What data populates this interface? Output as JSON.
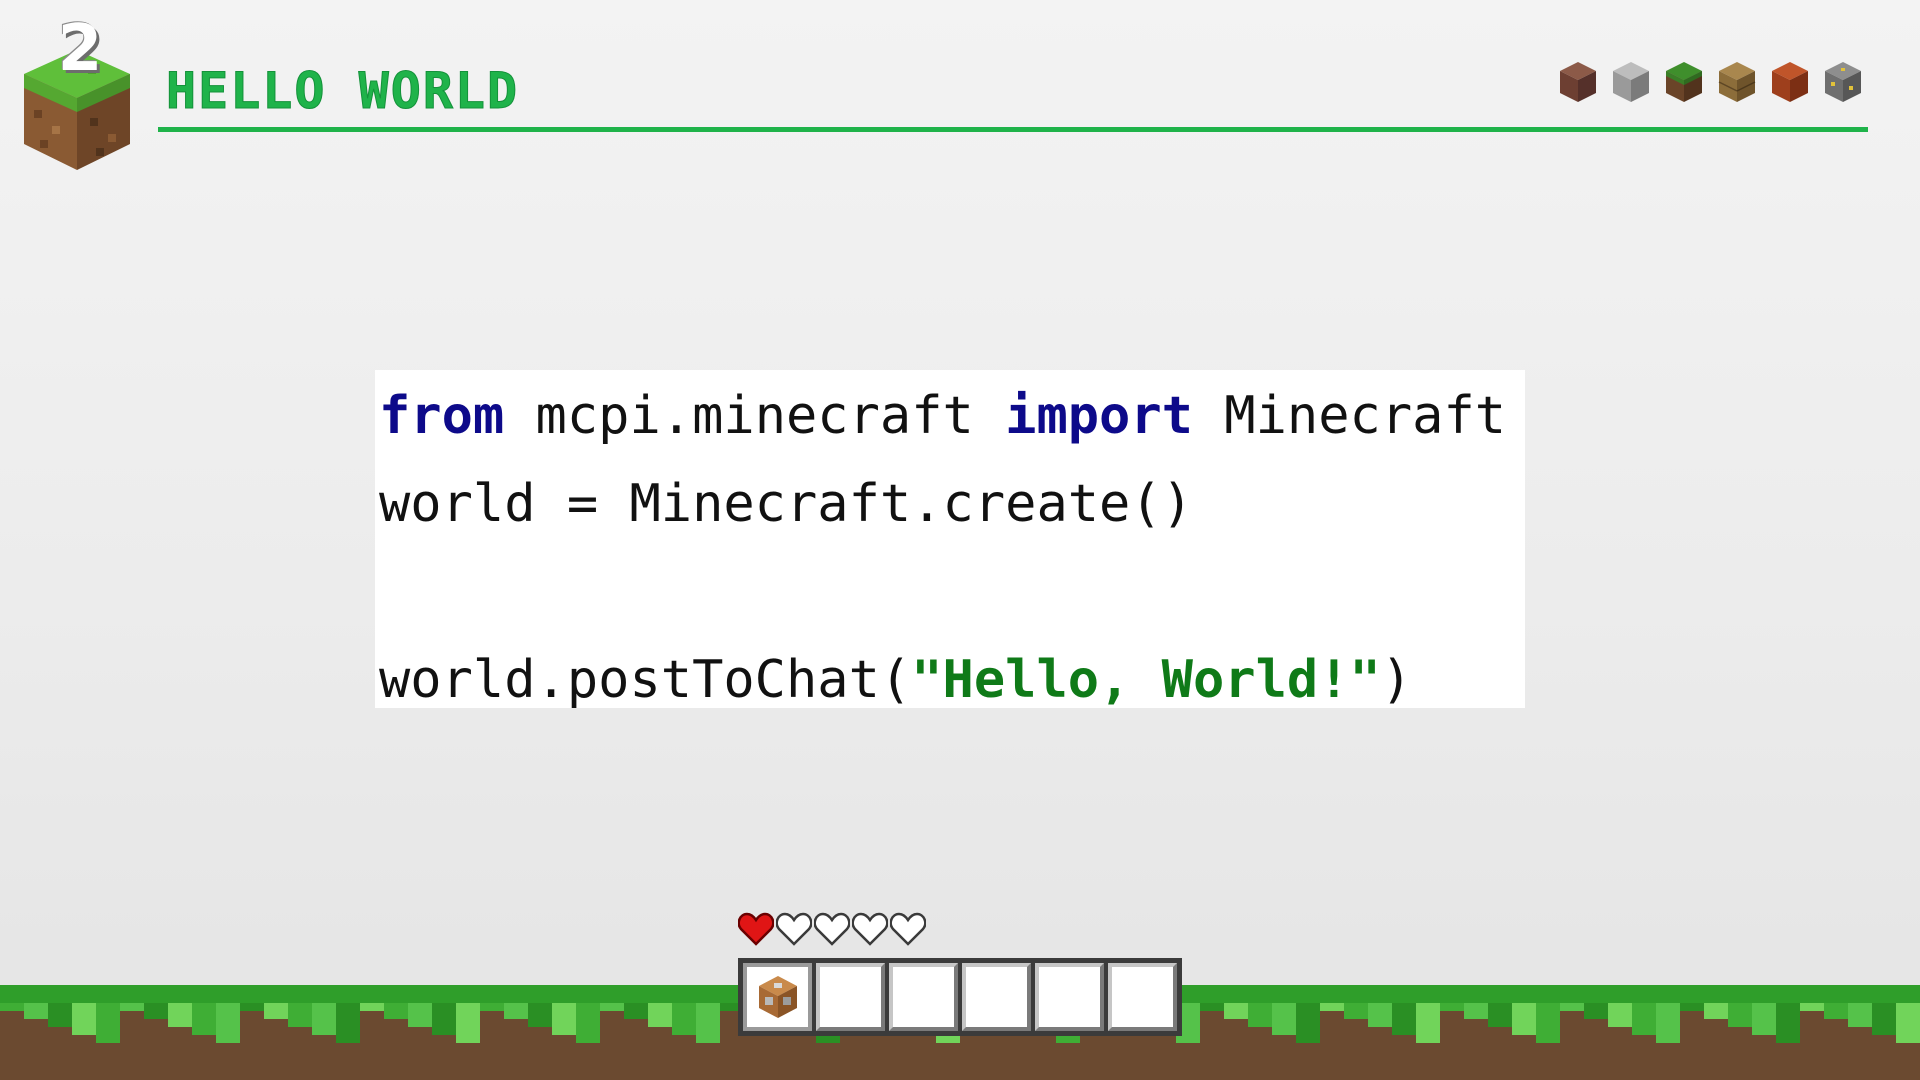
{
  "slide": {
    "number": "2",
    "title": "HELLO WORLD"
  },
  "header": {
    "block_icons": [
      "dirt-block-icon",
      "stone-block-icon",
      "grass-block-icon",
      "oak-planks-block-icon",
      "red-brick-block-icon",
      "gold-ore-block-icon"
    ]
  },
  "code": {
    "line1": {
      "kw1": "from",
      "module": " mcpi.minecraft ",
      "kw2": "import",
      "cls": " Minecraft"
    },
    "line2": "world = Minecraft.create()",
    "line4": {
      "call": "world.postToChat(",
      "string": "\"Hello, World!\"",
      "close": ")"
    }
  },
  "hud": {
    "hearts": [
      "full",
      "empty",
      "empty",
      "empty",
      "empty"
    ],
    "hotbar_selected_index": 0,
    "hotbar_slots": [
      "command-block-icon",
      "",
      "",
      "",
      "",
      ""
    ]
  },
  "colors": {
    "accent": "#1fb34a",
    "keyword": "#0d0a8a",
    "string": "#0f7a18"
  }
}
